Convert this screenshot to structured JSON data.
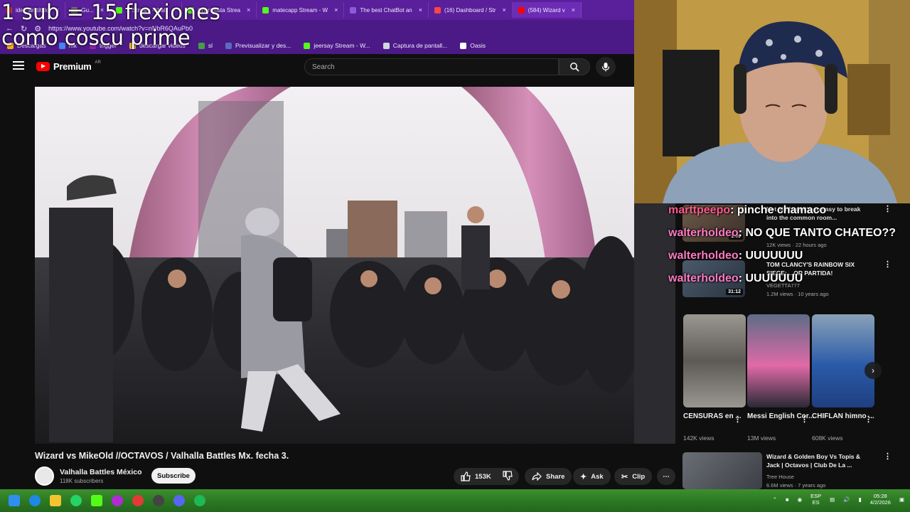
{
  "overlay": {
    "line1": "1 sub = 15 flexiones",
    "line2": "como coscu prime"
  },
  "browser": {
    "tabs": [
      {
        "label": "ideo sin título",
        "color": "#cc3333"
      },
      {
        "label": "Gu...",
        "color": "#777"
      },
      {
        "label": "... Stream - Wat",
        "color": "#53fc18"
      },
      {
        "label": "Choriposta Strea",
        "color": "#53fc18"
      },
      {
        "label": "matecapp Stream - W",
        "color": "#53fc18"
      },
      {
        "label": "The best ChatBot an",
        "color": "#8a5bd6"
      },
      {
        "label": "(16) Dashboard / Str",
        "color": "#ff4444"
      },
      {
        "label": "(584) Wizard v",
        "color": "#ff0000"
      }
    ],
    "url": "https://www.youtube.com/watch?v=nNbR6QAuPb0",
    "bookmarks": [
      {
        "label": "Descargas",
        "color": "#f4b400"
      },
      {
        "label": "mk",
        "color": "#4285f4"
      },
      {
        "label": "trigger",
        "color": "#8e24aa"
      },
      {
        "label": "descargar videos",
        "color": "#fbc02d"
      },
      {
        "label": "sl",
        "color": "#43a047"
      },
      {
        "label": "Previsualizar y des...",
        "color": "#5c6bc0"
      },
      {
        "label": "jeersay Stream - W...",
        "color": "#53fc18"
      },
      {
        "label": "Captura de pantall...",
        "color": "#cfd8dc"
      },
      {
        "label": "Oasis",
        "color": "#ffffff"
      }
    ]
  },
  "header": {
    "brand": "Premium",
    "region": "AR",
    "search_placeholder": "Search"
  },
  "video": {
    "title": "Wizard vs MikeOld //OCTAVOS / Valhalla Battles Mx. fecha 3.",
    "channel": "Valhalla Battles México",
    "subscribers": "118K subscribers",
    "subscribe_label": "Subscribe",
    "likes": "153K",
    "share_label": "Share",
    "ask_label": "Ask",
    "clip_label": "Clip"
  },
  "chat": [
    {
      "user": "marttpeepo",
      "message": ": pinche chamaco",
      "color": "#ff5a8c"
    },
    {
      "user": "walterholdeo",
      "message": ": NO QUE TANTO CHATEO??",
      "color": "#ff7ac3"
    },
    {
      "user": "walterholdeo",
      "message": ": UUUUUUU",
      "color": "#ff7ac3"
    },
    {
      "user": "walterholdeo",
      "message": ": UUUUUUU",
      "color": "#ff7ac3"
    }
  ],
  "sidebar": {
    "items": [
      {
        "title": "Not his fault it's so easy to break into the common room...",
        "meta": "12K views · 22 hours ago",
        "duration": "1:09"
      },
      {
        "title": "TOM CLANCY'S RAINBOW SIX SIEGE: ...OR PARTIDA!",
        "channel": "VEGETTA777",
        "meta": "1.2M views · 10 years ago",
        "duration": "31:12"
      }
    ],
    "shorts": [
      {
        "title": "CENSURAS en ...",
        "views": "142K views"
      },
      {
        "title": "Messi English Cor...",
        "views": "13M views"
      },
      {
        "title": "CHIFLAN himno ...",
        "views": "608K views"
      }
    ],
    "bottom_item": {
      "title": "Wizard & Golden Boy Vs Topis & Jack | Octavos | Club De La ...",
      "channel": "Tree House",
      "meta": "6.6M views · 7 years ago"
    }
  },
  "taskbar": {
    "lang1": "ESP",
    "lang2": "ES",
    "time": "05:28",
    "date": "4/2/2026"
  }
}
